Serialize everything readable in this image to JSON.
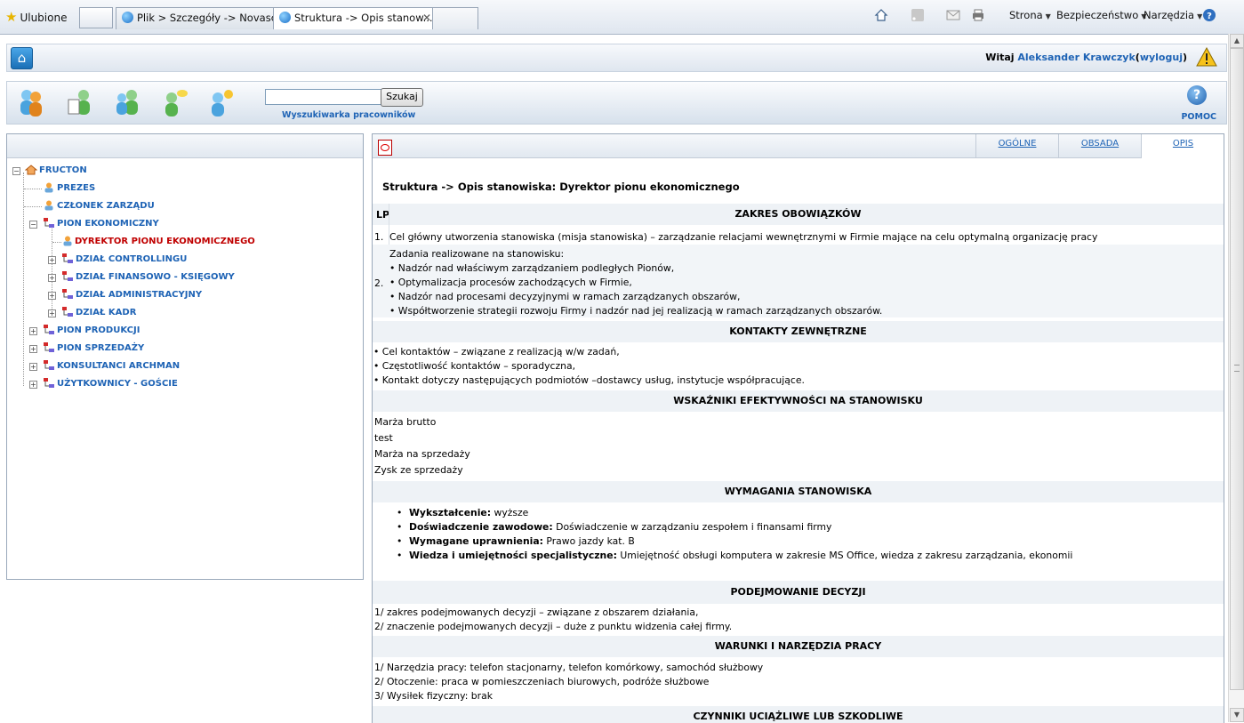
{
  "browser": {
    "favorites_label": "Ulubione",
    "tabs": [
      {
        "title": "Plik > Szczegóły -> Novasco..."
      },
      {
        "title": "Struktura -> Opis stanow..."
      }
    ],
    "commands": {
      "page": "Strona",
      "security": "Bezpieczeństwo",
      "tools": "Narzędzia"
    }
  },
  "header": {
    "welcome_prefix": "Witaj",
    "user_name": "Aleksander Krawczyk",
    "open_paren": "(",
    "logout": "wyloguj",
    "close_paren": ")"
  },
  "nav": {
    "search_placeholder": "",
    "search_button": "Szukaj",
    "search_caption": "Wyszukiwarka pracowników",
    "help_label": "POMOC",
    "help_glyph": "?"
  },
  "tree": {
    "root": "FRUCTON",
    "nodes": [
      "PREZES",
      "CZŁONEK ZARZĄDU",
      "PION EKONOMICZNY",
      "DYREKTOR PIONU EKONOMICZNEGO",
      "DZIAŁ CONTROLLINGU",
      "DZIAŁ FINANSOWO - KSIĘGOWY",
      "DZIAŁ ADMINISTRACYJNY",
      "DZIAŁ KADR",
      "PION PRODUKCJI",
      "PION SPRZEDAŻY",
      "KONSULTANCI ARCHMAN",
      "UŻYTKOWNICY - GOŚCIE"
    ]
  },
  "content": {
    "tabs": [
      "OGÓLNE",
      "OBSADA",
      "OPIS"
    ],
    "breadcrumb": "Struktura -> Opis stanowiska: Dyrektor pionu ekonomicznego",
    "lp_header": "LP",
    "sections": {
      "zakres": "ZAKRES OBOWIĄZKÓW",
      "kontakty": "KONTAKTY ZEWNĘTRZNE",
      "wskazniki": "WSKAŹNIKI EFEKTYWNOŚCI NA STANOWISKU",
      "wymagania": "WYMAGANIA STANOWISKA",
      "decyzje": "PODEJMOWANIE DECYZJI",
      "warunki": "WARUNKI I NARZĘDZIA PRACY",
      "czynniki": "CZYNNIKI UCIĄŻLIWE LUB SZKODLIWE"
    },
    "duties": [
      {
        "lp": "1.",
        "lines": [
          "Cel główny utworzenia stanowiska (misja stanowiska) – zarządzanie relacjami wewnętrznymi w Firmie mające na celu optymalną organizację pracy"
        ]
      },
      {
        "lp": "2.",
        "lines": [
          "Zadania realizowane na stanowisku:",
          "• Nadzór nad właściwym zarządzaniem podległych Pionów,",
          "• Optymalizacja procesów zachodzących w Firmie,",
          "• Nadzór nad procesami decyzyjnymi w ramach zarządzanych obszarów,",
          "• Współtworzenie strategii rozwoju Firmy i nadzór nad jej realizacją w ramach zarządzanych obszarów."
        ]
      }
    ],
    "contacts": [
      "• Cel kontaktów – związane z realizacją w/w zadań,",
      "• Częstotliwość kontaktów – sporadyczna,",
      "• Kontakt dotyczy następujących podmiotów –dostawcy usług, instytucje współpracujące."
    ],
    "kpis": [
      "Marża brutto",
      "test",
      "Marża na sprzedaży",
      "Zysk ze sprzedaży"
    ],
    "requirements": [
      {
        "label": "Wykształcenie:",
        "value": "wyższe"
      },
      {
        "label": "Doświadczenie zawodowe:",
        "value": "Doświadczenie w zarządzaniu zespołem i finansami firmy"
      },
      {
        "label": "Wymagane uprawnienia:",
        "value": "Prawo jazdy kat. B"
      },
      {
        "label": "Wiedza i umiejętności specjalistyczne:",
        "value": "Umiejętność obsługi komputera w zakresie MS Office, wiedza z zakresu zarządzania, ekonomii"
      }
    ],
    "decisions": [
      "1/ zakres podejmowanych decyzji – związane z obszarem działania,",
      "2/ znaczenie podejmowanych decyzji – duże z punktu widzenia całej firmy."
    ],
    "conditions": [
      "1/ Narzędzia pracy: telefon stacjonarny, telefon komórkowy, samochód służbowy",
      "2/ Otoczenie: praca w pomieszczeniach biurowych, podróże służbowe",
      "3/ Wysiłek fizyczny: brak"
    ]
  },
  "colors": {
    "link": "#1e63b5",
    "selected": "#c00000",
    "section_bg": "#eef2f6"
  }
}
